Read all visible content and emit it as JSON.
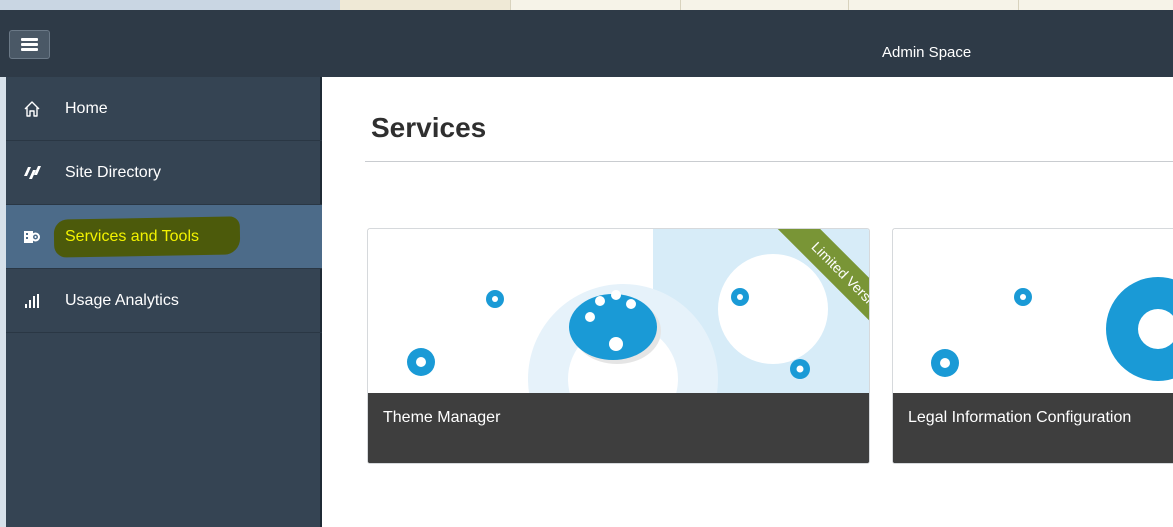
{
  "shell": {
    "title": "Admin Space",
    "menu_icon": "hamburger-menu-icon"
  },
  "sidebar": {
    "items": [
      {
        "label": "Home",
        "icon": "home-icon",
        "selected": false
      },
      {
        "label": "Site Directory",
        "icon": "site-directory-icon",
        "selected": false
      },
      {
        "label": "Services and Tools",
        "icon": "services-tools-icon",
        "selected": true,
        "highlighted": true
      },
      {
        "label": "Usage Analytics",
        "icon": "bar-chart-icon",
        "selected": false
      }
    ]
  },
  "main": {
    "title": "Services",
    "tiles": [
      {
        "label": "Theme Manager",
        "badge": "Limited Version",
        "icon": "palette-icon"
      },
      {
        "label": "Legal Information Configuration",
        "icon": "gear-icon"
      }
    ]
  },
  "colors": {
    "shell_bg": "#2e3a47",
    "sidebar_bg": "#354453",
    "selected_bg": "#4c6b89",
    "highlight_text": "#f3f300",
    "accent_blue": "#1a9ad6",
    "ribbon_green": "#799536"
  }
}
